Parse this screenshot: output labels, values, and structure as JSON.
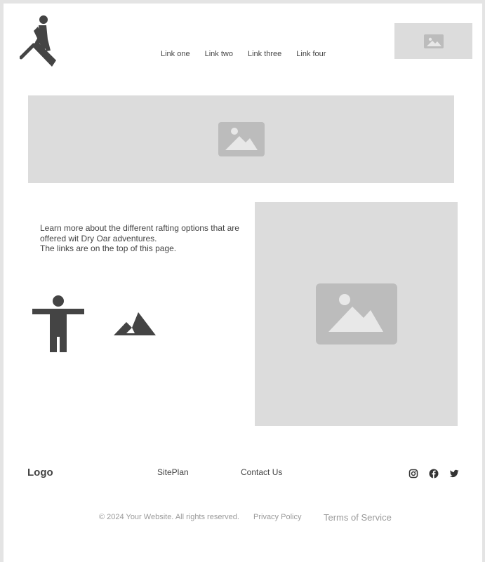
{
  "header": {
    "logo_icon": "rowing-person-icon",
    "nav": [
      "Link one",
      "Link two",
      "Link three",
      "Link four"
    ],
    "image_icon": "image-placeholder-icon"
  },
  "hero": {
    "image_icon": "image-placeholder-icon"
  },
  "content": {
    "description_lines": [
      "Learn more about the different rafting options that are offered wit Dry Oar adventures.",
      "The links are on the top of this page."
    ],
    "icons": [
      "person-icon",
      "mountain-icon"
    ],
    "side_image_icon": "image-placeholder-icon"
  },
  "footer": {
    "logo": "Logo",
    "links": [
      "SitePlan",
      "Contact Us"
    ],
    "social": [
      "instagram-icon",
      "facebook-icon",
      "twitter-icon"
    ],
    "copyright": "© 2024 Your Website. All rights reserved.",
    "privacy": "Privacy Policy",
    "terms": "Terms of Service"
  },
  "colors": {
    "placeholder_bg": "#dcdcdc",
    "placeholder_icon": "#bcbcbc",
    "icon_dark": "#444444",
    "muted_text": "#9a9a9a"
  }
}
